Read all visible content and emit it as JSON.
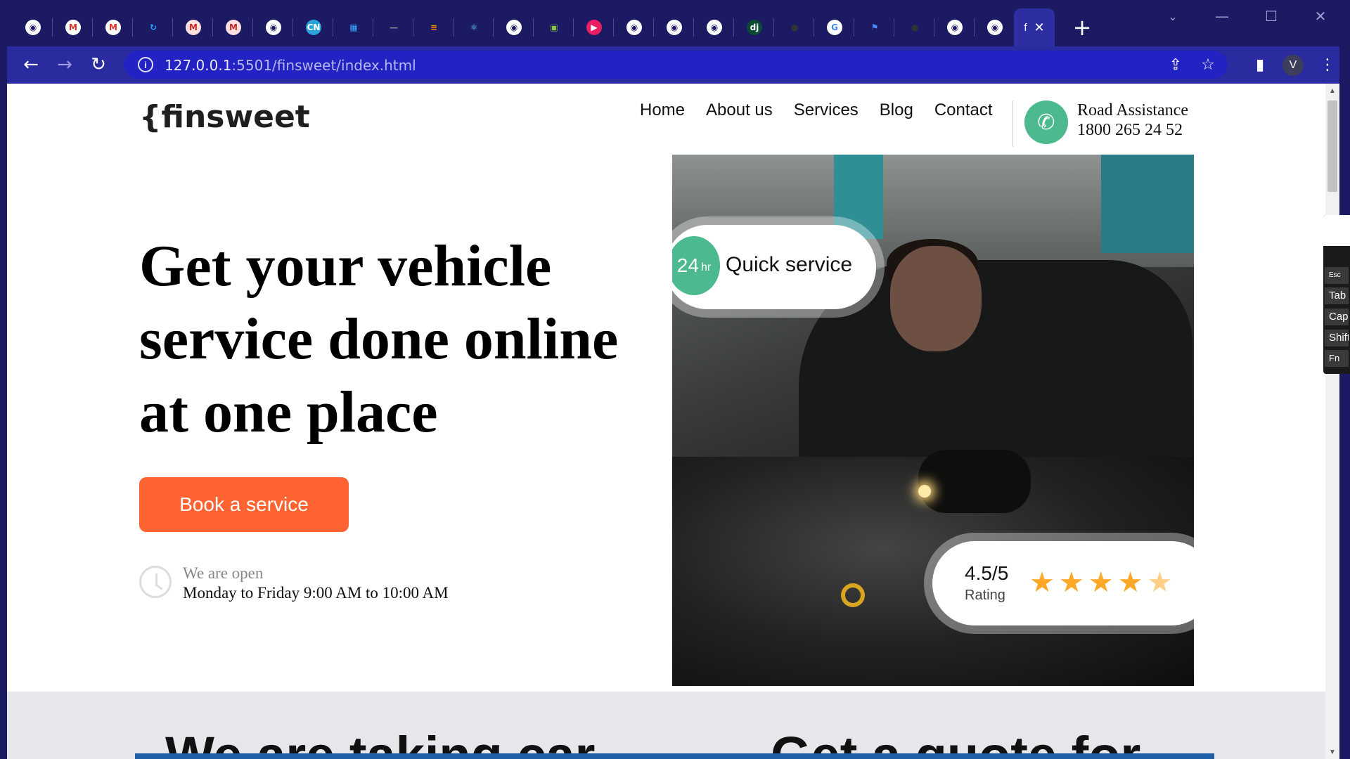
{
  "browser": {
    "tabs": [
      {
        "icon": "globe-icon"
      },
      {
        "icon": "gmail-icon"
      },
      {
        "icon": "gmail-icon"
      },
      {
        "icon": "refresh-icon"
      },
      {
        "icon": "m-icon"
      },
      {
        "icon": "m-icon"
      },
      {
        "icon": "globe-icon"
      },
      {
        "icon": "cn-icon"
      },
      {
        "icon": "puzzle-icon"
      },
      {
        "icon": "dash-icon"
      },
      {
        "icon": "bars-icon"
      },
      {
        "icon": "react-icon"
      },
      {
        "icon": "globe-icon"
      },
      {
        "icon": "pi-icon"
      },
      {
        "icon": "play-icon"
      },
      {
        "icon": "globe-icon"
      },
      {
        "icon": "globe-icon"
      },
      {
        "icon": "globe-icon"
      },
      {
        "icon": "django-icon"
      },
      {
        "icon": "github-icon"
      },
      {
        "icon": "google-icon"
      },
      {
        "icon": "flag-icon"
      },
      {
        "icon": "github-icon"
      },
      {
        "icon": "globe-icon"
      },
      {
        "icon": "globe-icon"
      }
    ],
    "active_tab_label": "f",
    "close_glyph": "✕",
    "new_tab_glyph": "+",
    "url_host": "127.0.0.1",
    "url_rest": ":5501/finsweet/index.html",
    "avatar_letter": "V",
    "colors": {
      "tabbar": "#1b1a63",
      "toolbar": "#2b2ba0",
      "omnibox": "#2323c3"
    }
  },
  "header": {
    "logo": "{finsweet",
    "nav": [
      "Home",
      "About us",
      "Services",
      "Blog",
      "Contact"
    ],
    "assist_title": "Road Assistance",
    "assist_phone": "1800 265 24 52"
  },
  "hero": {
    "title": "Get your vehicle service done online at one place",
    "cta": "Book a service",
    "open_label": "We are open",
    "open_hours": "Monday to Friday 9:00 AM to 10:00 AM",
    "quick_badge_num": "24",
    "quick_badge_unit": "hr",
    "quick_text": "Quick service",
    "rating_value": "4.5/5",
    "rating_label": "Rating",
    "rating_stars": 4.5,
    "colors": {
      "cta": "#ff6331",
      "accent": "#4cba8e",
      "stars": "#ffa726"
    }
  },
  "next_section": {
    "left_heading": "We are taking car",
    "right_heading": "Get a quote for"
  },
  "osk": {
    "keys": [
      "Esc",
      "Tab",
      "Caps",
      "Shift",
      "Fn"
    ]
  }
}
